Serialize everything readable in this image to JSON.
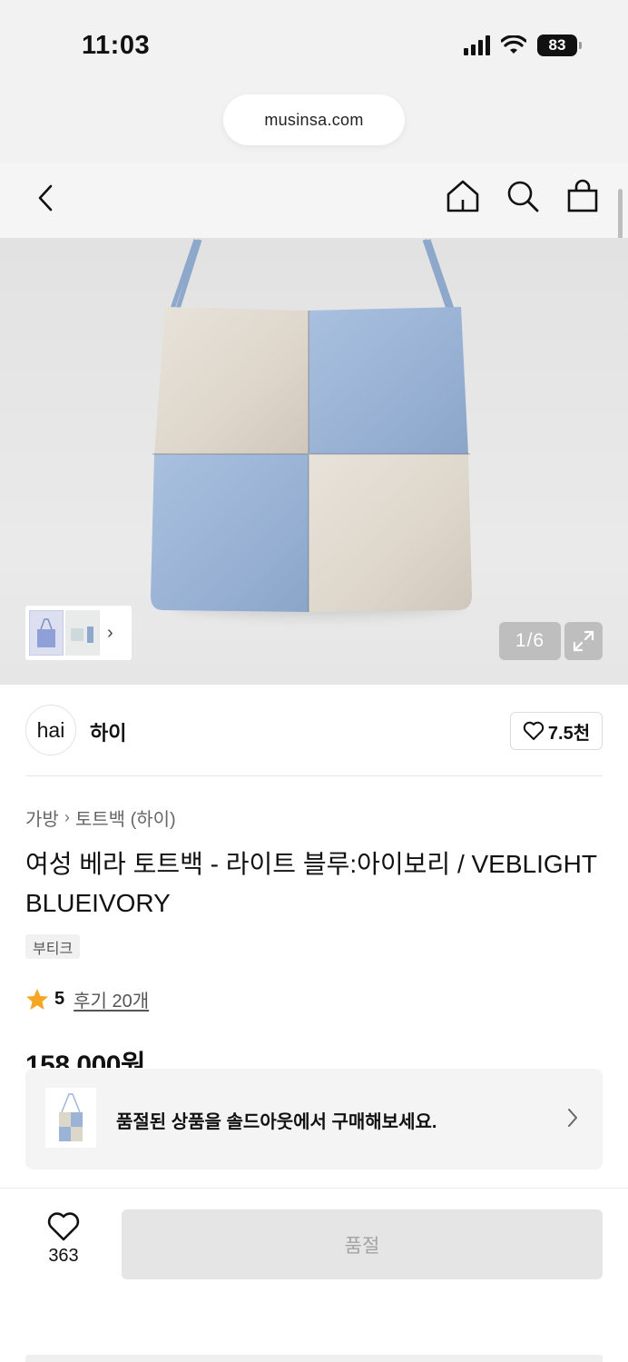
{
  "status_bar": {
    "time": "11:03",
    "battery": "83"
  },
  "browser": {
    "url": "musinsa.com"
  },
  "gallery": {
    "counter": "1/6"
  },
  "brand": {
    "logo_text": "hai",
    "name": "하이",
    "like_count": "7.5천"
  },
  "breadcrumb": {
    "category": "가방",
    "subcategory": "토트백 (하이)"
  },
  "product": {
    "title": "여성 베라 토트백 - 라이트 블루:아이보리 / VEBLIGHTBLUEIVORY",
    "tag": "부티크",
    "rating": "5",
    "review_link": "후기 20개",
    "price": "158,000원"
  },
  "soldout_banner": {
    "text": "품절된 상품을 솔드아웃에서 구매해보세요."
  },
  "bottom_bar": {
    "wish_count": "363",
    "buy_button_label": "품절"
  },
  "colors": {
    "bag_blue": "#9bb4d6",
    "bag_ivory": "#ddd6cb",
    "star": "#f5a623",
    "disabled_button": "#e5e5e5"
  }
}
